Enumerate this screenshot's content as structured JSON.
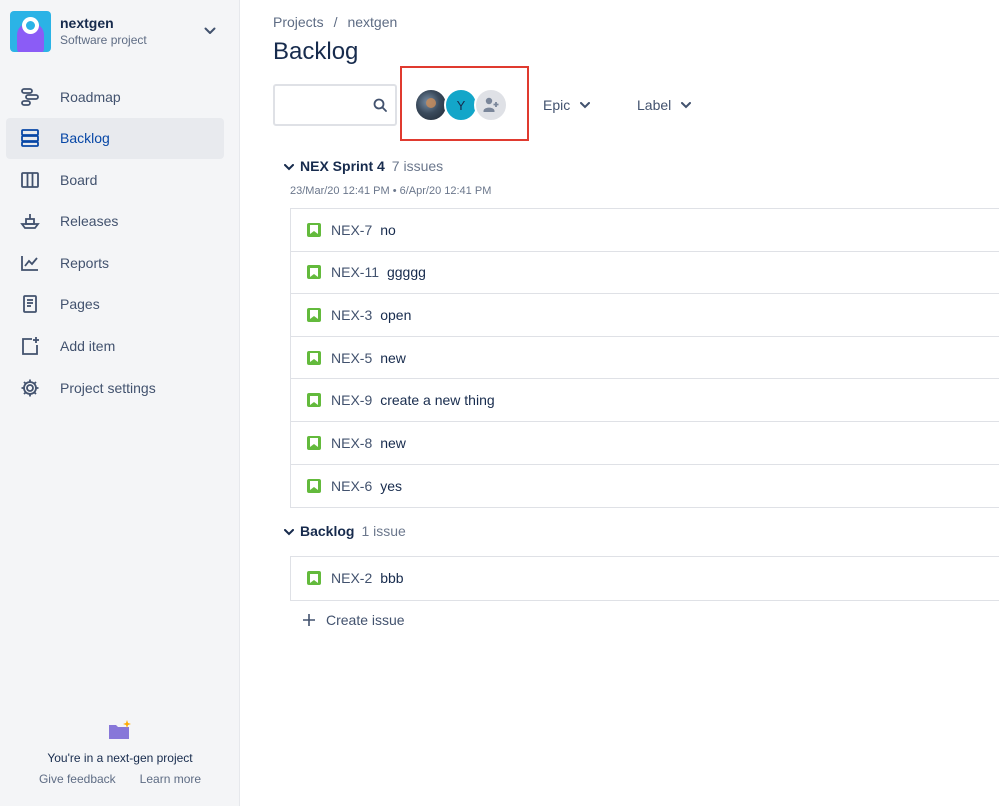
{
  "project": {
    "name": "nextgen",
    "type": "Software project",
    "brand_color": "#2BB3E6"
  },
  "nav": {
    "items": [
      {
        "label": "Roadmap",
        "icon": "roadmap-icon"
      },
      {
        "label": "Backlog",
        "icon": "backlog-icon",
        "active": true
      },
      {
        "label": "Board",
        "icon": "board-icon"
      },
      {
        "label": "Releases",
        "icon": "releases-icon"
      },
      {
        "label": "Reports",
        "icon": "reports-icon"
      },
      {
        "label": "Pages",
        "icon": "pages-icon"
      },
      {
        "label": "Add item",
        "icon": "add-item-icon"
      },
      {
        "label": "Project settings",
        "icon": "gear-icon"
      }
    ]
  },
  "footer": {
    "text": "You're in a next-gen project",
    "give_feedback": "Give feedback",
    "learn_more": "Learn more"
  },
  "breadcrumb": {
    "projects": "Projects",
    "separator": "/",
    "current": "nextgen"
  },
  "page_title": "Backlog",
  "toolbar": {
    "avatar_initial": "Y",
    "epic_filter": "Epic",
    "label_filter": "Label",
    "highlight_color": "#E03A2F"
  },
  "sprint": {
    "title": "NEX Sprint 4",
    "count": "7 issues",
    "dates": "23/Mar/20 12:41 PM • 6/Apr/20 12:41 PM",
    "issues": [
      {
        "key": "NEX-7",
        "summary": "no"
      },
      {
        "key": "NEX-11",
        "summary": "ggggg"
      },
      {
        "key": "NEX-3",
        "summary": "open"
      },
      {
        "key": "NEX-5",
        "summary": "new"
      },
      {
        "key": "NEX-9",
        "summary": "create a new thing"
      },
      {
        "key": "NEX-8",
        "summary": "new"
      },
      {
        "key": "NEX-6",
        "summary": "yes"
      }
    ]
  },
  "backlog": {
    "title": "Backlog",
    "count": "1 issue",
    "issues": [
      {
        "key": "NEX-2",
        "summary": "bbb"
      }
    ],
    "create_issue": "Create issue"
  },
  "colors": {
    "story": "#63BA3C",
    "active_nav": "#0747A6",
    "sidebar_bg": "#F4F5F7"
  }
}
